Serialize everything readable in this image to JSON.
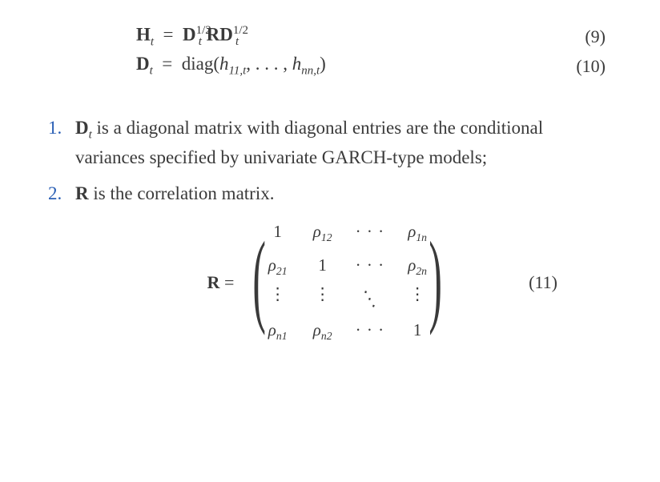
{
  "equations": {
    "eq9": {
      "lhs": "H",
      "lhs_sub": "t",
      "rhs_base1": "D",
      "rhs_sup1": "1/2",
      "rhs_sub1": "t",
      "rhs_mid": "R",
      "rhs_base2": "D",
      "rhs_sup2": "1/2",
      "rhs_sub2": "t",
      "number": "(9)"
    },
    "eq10": {
      "lhs": "D",
      "lhs_sub": "t",
      "fn": "diag",
      "arg1_base": "h",
      "arg1_sub": "11,t",
      "argn_base": "h",
      "argn_sub": "nn,t",
      "number": "(10)"
    },
    "eq11": {
      "lhs": "R",
      "number": "(11)"
    }
  },
  "list": {
    "item1": {
      "num": "1.",
      "text_pre": " is a diagonal matrix with diagonal entries are the conditional variances specified by univariate GARCH-type models;",
      "bold_var": "D",
      "bold_sub": "t"
    },
    "item2": {
      "num": "2.",
      "bold_var": "R",
      "text": " is the correlation matrix."
    }
  },
  "matrix": {
    "rows": [
      [
        "1",
        "ρ12",
        "···",
        "ρ1n"
      ],
      [
        "ρ21",
        "1",
        "···",
        "ρ2n"
      ],
      [
        "⋮",
        "⋮",
        "⋱",
        "⋮"
      ],
      [
        "ρn1",
        "ρn2",
        "···",
        "1"
      ]
    ],
    "r00": "1",
    "r01_base": "ρ",
    "r01_sub": "12",
    "r02": "· · ·",
    "r03_base": "ρ",
    "r03_sub": "1n",
    "r10_base": "ρ",
    "r10_sub": "21",
    "r11": "1",
    "r12": "· · ·",
    "r13_base": "ρ",
    "r13_sub": "2n",
    "r20": "⋮",
    "r21": "⋮",
    "r22": "⋱",
    "r23": "⋮",
    "r30_base": "ρ",
    "r30_sub": "n1",
    "r31_base": "ρ",
    "r31_sub": "n2",
    "r32": "· · ·",
    "r33": "1"
  }
}
